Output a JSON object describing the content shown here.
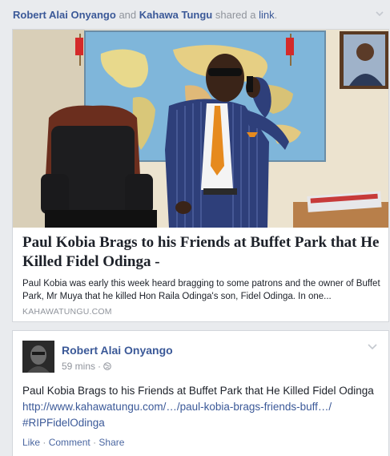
{
  "shared_header": {
    "actor1": "Robert Alai Onyango",
    "and_word": "and",
    "actor2": "Kahawa Tungu",
    "verb": "shared a",
    "link_word": "link",
    "period": "."
  },
  "link_card": {
    "title": "Paul Kobia Brags to his Friends at Buffet Park that He Killed Fidel Odinga -",
    "description": "Paul Kobia was early this week heard bragging to some patrons and the owner of Buffet Park, Mr Muya that he killed Hon Raila Odinga's son, Fidel Odinga. In one...",
    "domain": "KAHAWATUNGU.COM"
  },
  "post": {
    "author": "Robert Alai Onyango",
    "time": "59 mins",
    "dot": "·",
    "text": "Paul Kobia Brags to his Friends at Buffet Park that He Killed Fidel Odinga",
    "url": "http://www.kahawatungu.com/…/paul-kobia-brags-friends-buff…/",
    "hashtag": "#RIPFidelOdinga",
    "actions": {
      "like": "Like",
      "comment": "Comment",
      "share": "Share",
      "sep": "·"
    }
  },
  "icons": {
    "header_menu": "chevron-down-icon",
    "post_menu": "chevron-down-icon",
    "privacy": "globe-icon"
  }
}
